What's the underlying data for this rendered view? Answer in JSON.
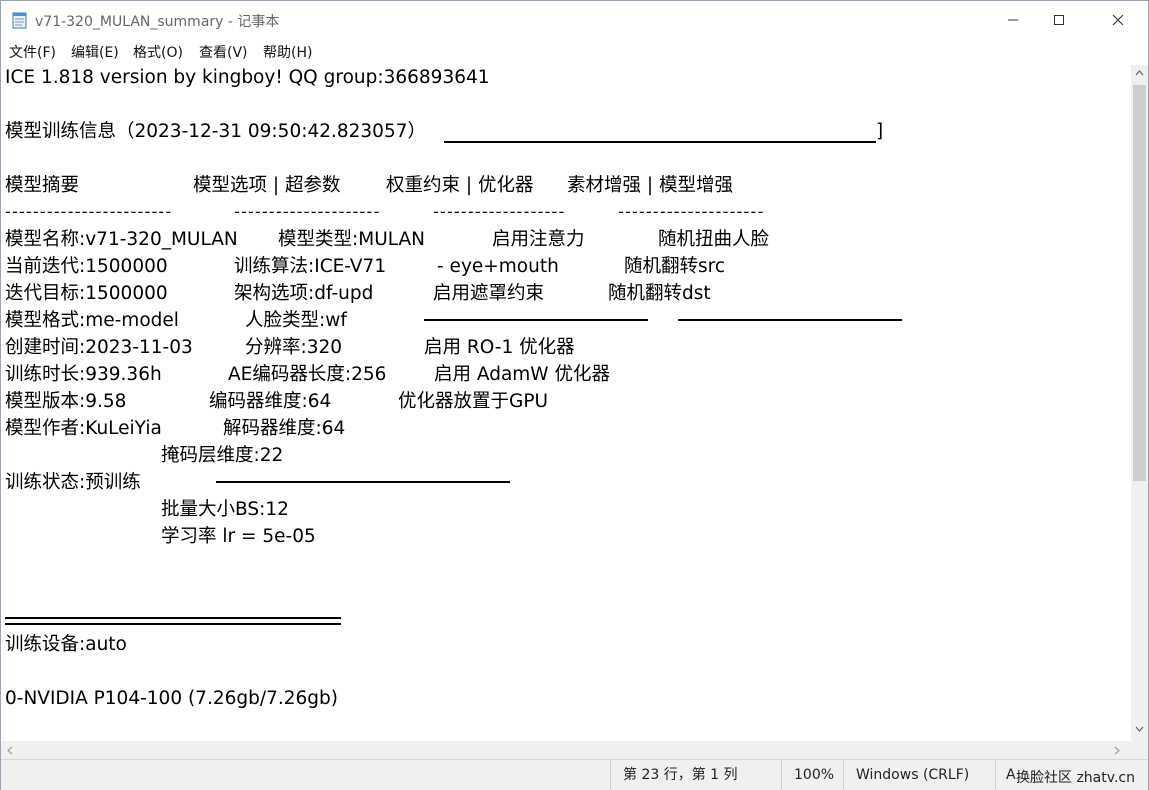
{
  "window": {
    "title": "v71-320_MULAN_summary - 记事本",
    "minimize_glyph": "—",
    "maximize_glyph": "☐",
    "close_glyph": "✕"
  },
  "menu": {
    "items": [
      {
        "label": "文件(F)"
      },
      {
        "label": "编辑(E)"
      },
      {
        "label": "格式(O)"
      },
      {
        "label": "查看(V)"
      },
      {
        "label": "帮助(H)"
      }
    ]
  },
  "content": {
    "header": "ICE 1.818 version by kingboy! QQ group:366893641",
    "info_title": "模型训练信息（2023-12-31 09:50:42.823057）",
    "info_title_end": "]",
    "sections": {
      "summary": "模型摘要",
      "options": "模型选项 | 超参数",
      "weights": "权重约束 | 优化器",
      "augment": "素材增强 | 模型增强"
    },
    "dash_cols": [
      "------------------------",
      "---------------------",
      "-------------------",
      "---------------------"
    ],
    "col1": [
      "模型名称:v71-320_MULAN",
      "当前迭代:1500000",
      "迭代目标:1500000",
      "模型格式:me-model",
      "创建时间:2023-11-03",
      "训练时长:939.36h",
      "模型版本:9.58",
      "模型作者:KuLeiYia"
    ],
    "status_line": "训练状态:预训练",
    "col2": [
      "模型类型:MULAN",
      "训练算法:ICE-V71",
      "架构选项:df-upd",
      "人脸类型:wf",
      "分辨率:320",
      "AE编码器长度:256",
      "编码器维度:64",
      "解码器维度:64",
      "掩码层维度:22",
      "批量大小BS:12",
      "学习率 lr = 5e-05"
    ],
    "col3": [
      "启用注意力",
      "- eye+mouth",
      "启用遮罩约束",
      "启用 RO-1 优化器",
      "启用 AdamW 优化器",
      "优化器放置于GPU"
    ],
    "col4": [
      "随机扭曲人脸",
      "随机翻转src",
      "随机翻转dst"
    ],
    "device_label": "训练设备:auto",
    "device": " 0-NVIDIA P104-100 (7.26gb/7.26gb)"
  },
  "status": {
    "position": "第 23 行，第 1 列",
    "zoom": "100%",
    "line_ending": "Windows (CRLF)",
    "encoding": "A",
    "watermark": "换脸社区 zhatv.cn"
  }
}
